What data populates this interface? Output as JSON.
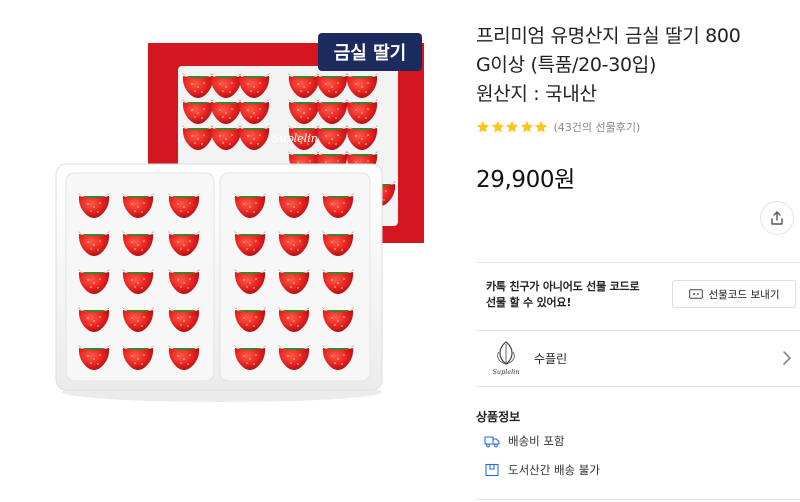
{
  "product": {
    "title_line1": "프리미엄 유명산지 금실 딸기 800",
    "title_line2": "G이상 (특품/20-30입)",
    "title_line3": "원산지 : 국내산",
    "rating_stars": 5,
    "review_text": "(43건의 선물후기)",
    "price": "29,900원",
    "image_badge": "금실 딸기",
    "image_brand": "Suplelin"
  },
  "gift": {
    "text_line1": "카톡 친구가 아니어도 선물 코드로",
    "text_line2": "선물 할 수 있어요!",
    "button_label": "선물코드 보내기"
  },
  "seller": {
    "name": "수플린",
    "logo_text": "Suplelin"
  },
  "info": {
    "title": "상품정보",
    "shipping": "배송비 포함",
    "remote": "도서산간 배송 불가"
  },
  "colors": {
    "star": "#ffc51a",
    "box_red": "#d4161f",
    "badge_navy": "#1c2b5e"
  }
}
